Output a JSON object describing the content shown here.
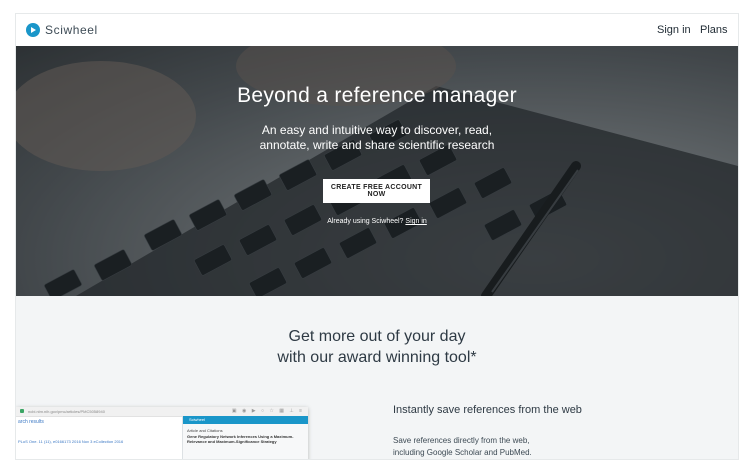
{
  "nav": {
    "brand": "Sciwheel",
    "signin": "Sign in",
    "plans": "Plans"
  },
  "hero": {
    "title": "Beyond a reference manager",
    "subtitle_line1": "An easy and intuitive way to discover, read,",
    "subtitle_line2": "annotate, write and share scientific research",
    "cta": "CREATE FREE ACCOUNT NOW",
    "already_text": "Already using Sciwheel?",
    "already_link": "Sign in"
  },
  "section": {
    "title_line1": "Get more out of your day",
    "title_line2": "with our award winning tool*"
  },
  "feature": {
    "title": "Instantly save references from the web",
    "desc_line1": "Save references directly from the web,",
    "desc_line2": "including Google Scholar and PubMed."
  },
  "preview": {
    "url": "ncbi.nlm.nih.gov/pmc/articles/PMC5058940",
    "left_title": "arch results",
    "left_meta": "PLoS One. 11 (11), e0166173  2016 Nov 3  eCollection 2016",
    "panel_header": "Sciwheel",
    "panel_label": "Article and Citations",
    "panel_item": "Gene Regulatory Network Inferences Using a Maximum-Relevance and Maximum-Significance Strategy"
  },
  "colors": {
    "brand_blue": "#1a96c9",
    "page_bg": "#f3f5f6",
    "text_dark": "#2e3a44"
  }
}
